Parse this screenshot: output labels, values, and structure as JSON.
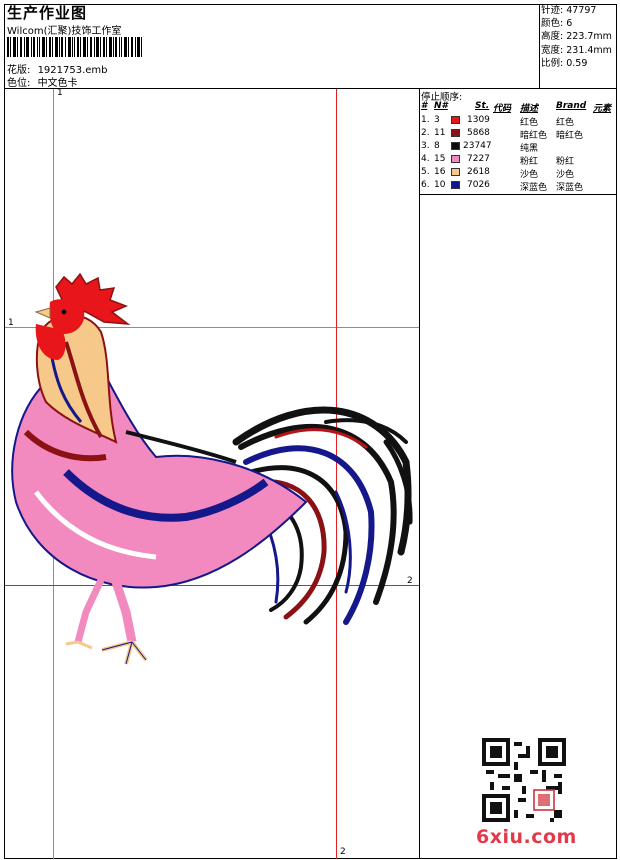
{
  "header": {
    "title": "生产作业图",
    "studio": "Wilcom(汇聚)技饰工作室",
    "design_label": "花版:",
    "design_file": "1921753.emb",
    "color_label": "色位:",
    "color_card": "中文色卡"
  },
  "stats": [
    {
      "label": "针迹:",
      "value": "47797"
    },
    {
      "label": "颜色:",
      "value": "6"
    },
    {
      "label": "高度:",
      "value": "223.7mm"
    },
    {
      "label": "宽度:",
      "value": "231.4mm"
    },
    {
      "label": "比例:",
      "value": "0.59"
    }
  ],
  "stop_sequence": {
    "title": "停止顺序:",
    "headers": [
      "#",
      "N#",
      "St.",
      "代码",
      "描述",
      "Brand",
      "元素"
    ],
    "rows": [
      {
        "order": "1.",
        "needle": "3",
        "color": "#e8151b",
        "stitches": "1309",
        "desc": "红色",
        "brand": "红色"
      },
      {
        "order": "2.",
        "needle": "11",
        "color": "#8b1214",
        "stitches": "5868",
        "desc": "暗红色",
        "brand": "暗红色"
      },
      {
        "order": "3.",
        "needle": "8",
        "color": "#0a0a0a",
        "stitches": "23747",
        "desc": "纯黑",
        "brand": ""
      },
      {
        "order": "4.",
        "needle": "15",
        "color": "#f28ac0",
        "stitches": "7227",
        "desc": "粉红",
        "brand": "粉红"
      },
      {
        "order": "5.",
        "needle": "16",
        "color": "#f6c98a",
        "stitches": "2618",
        "desc": "沙色",
        "brand": "沙色"
      },
      {
        "order": "6.",
        "needle": "10",
        "color": "#12168c",
        "stitches": "7026",
        "desc": "深蓝色",
        "brand": "深蓝色"
      }
    ]
  },
  "guides": {
    "v1": "1",
    "h1": "1",
    "h2": "2",
    "v2": "2"
  },
  "watermark": "6xiu.com"
}
